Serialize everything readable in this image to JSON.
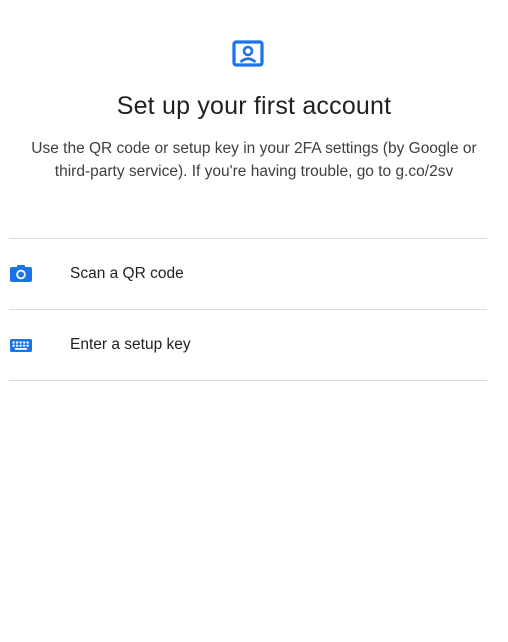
{
  "header": {
    "icon": "qr-account-icon",
    "title": "Set up your first account",
    "description": "Use the QR code or setup key in your 2FA settings (by Google or third-party service). If you're having trouble, go to g.co/2sv"
  },
  "options": [
    {
      "icon": "camera-icon",
      "label": "Scan a QR code"
    },
    {
      "icon": "keyboard-icon",
      "label": "Enter a setup key"
    }
  ],
  "colors": {
    "accent": "#1a73e8",
    "divider": "#dadce0",
    "text": "#202124"
  }
}
